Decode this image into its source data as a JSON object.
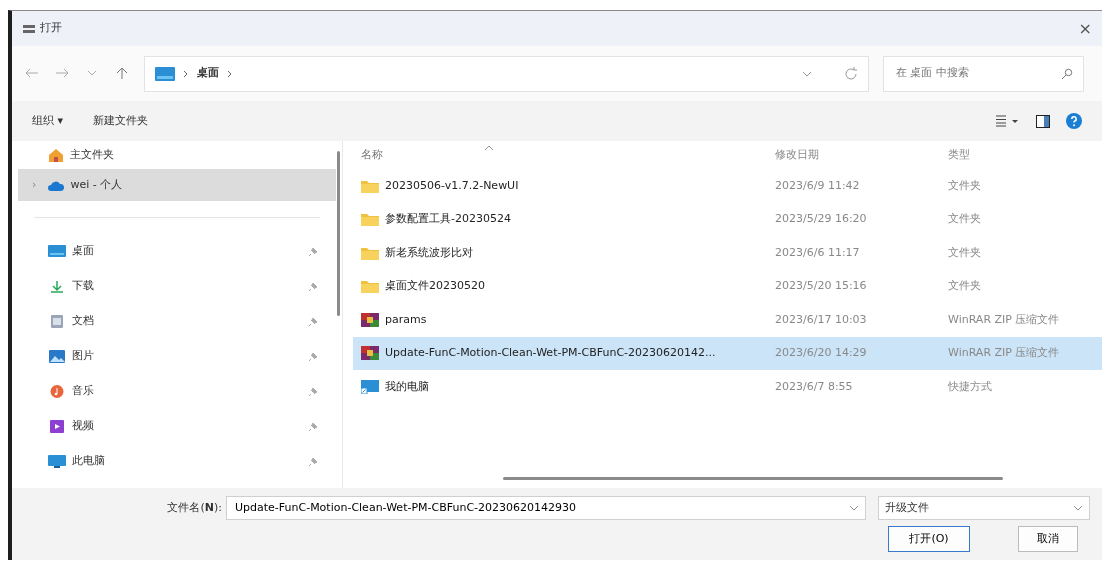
{
  "window": {
    "title": "打开",
    "close": "×"
  },
  "nav": {
    "path": [
      {
        "label": "桌面"
      }
    ],
    "search": {
      "placeholder": "在 桌面 中搜索"
    }
  },
  "toolbar": {
    "organize": "组织 ▾",
    "new_folder": "新建文件夹"
  },
  "sidebar": {
    "items": [
      {
        "label": "主文件夹",
        "selected": false
      },
      {
        "label": "wei - 个人",
        "selected": true,
        "expander": "›"
      }
    ],
    "pinned": [
      {
        "label": "桌面"
      },
      {
        "label": "下载"
      },
      {
        "label": "文档"
      },
      {
        "label": "图片"
      },
      {
        "label": "音乐"
      },
      {
        "label": "视频"
      },
      {
        "label": "此电脑"
      }
    ]
  },
  "table": {
    "columns": [
      "名称",
      "修改日期",
      "类型"
    ],
    "rows": [
      {
        "kind": "folder",
        "name": "20230506-v1.7.2-NewUI",
        "date": "2023/6/9 11:42",
        "type": "文件夹",
        "selected": false
      },
      {
        "kind": "folder",
        "name": "参数配置工具-20230524",
        "date": "2023/5/29 16:20",
        "type": "文件夹",
        "selected": false
      },
      {
        "kind": "folder",
        "name": "新老系统波形比对",
        "date": "2023/6/6 11:17",
        "type": "文件夹",
        "selected": false
      },
      {
        "kind": "folder",
        "name": "桌面文件20230520",
        "date": "2023/5/20 15:16",
        "type": "文件夹",
        "selected": false
      },
      {
        "kind": "archive",
        "name": "params",
        "date": "2023/6/17 10:03",
        "type": "WinRAR ZIP 压缩文件",
        "selected": false
      },
      {
        "kind": "archive",
        "name": "Update-FunC-Motion-Clean-Wet-PM-CBFunC-20230620142...",
        "date": "2023/6/20 14:29",
        "type": "WinRAR ZIP 压缩文件",
        "selected": true
      },
      {
        "kind": "shortcut",
        "name": "我的电脑",
        "date": "2023/6/7 8:55",
        "type": "快捷方式",
        "selected": false
      }
    ]
  },
  "footer": {
    "filename_label": "文件名(**N**):",
    "filename": "Update-FunC-Motion-Clean-Wet-PM-CBFunC-20230620142930",
    "filter": "升级文件",
    "open": "打开(O)",
    "cancel": "取消"
  }
}
